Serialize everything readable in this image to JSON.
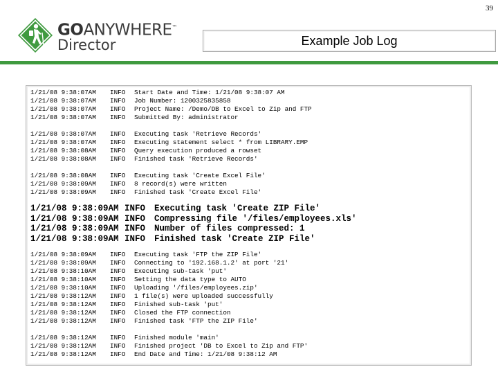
{
  "page_number": "39",
  "logo": {
    "brand_go": "GO",
    "brand_rest": "ANYWHERE",
    "brand_tm": "™",
    "product": "Director"
  },
  "title": "Example Job Log",
  "log_blocks": [
    {
      "emphasis": false,
      "entries": [
        {
          "time": "1/21/08 9:38:07AM",
          "level": "INFO",
          "message": "Start Date and Time: 1/21/08 9:38:07 AM"
        },
        {
          "time": "1/21/08 9:38:07AM",
          "level": "INFO",
          "message": "Job Number: 1200325835858"
        },
        {
          "time": "1/21/08 9:38:07AM",
          "level": "INFO",
          "message": "Project Name: /Demo/DB to Excel to Zip and FTP"
        },
        {
          "time": "1/21/08 9:38:07AM",
          "level": "INFO",
          "message": "Submitted By: administrator"
        }
      ]
    },
    {
      "emphasis": false,
      "entries": [
        {
          "time": "1/21/08 9:38:07AM",
          "level": "INFO",
          "message": "Executing task 'Retrieve Records'"
        },
        {
          "time": "1/21/08 9:38:07AM",
          "level": "INFO",
          "message": "Executing statement select * from LIBRARY.EMP"
        },
        {
          "time": "1/21/08 9:38:08AM",
          "level": "INFO",
          "message": "Query execution produced a rowset"
        },
        {
          "time": "1/21/08 9:38:08AM",
          "level": "INFO",
          "message": "Finished task 'Retrieve Records'"
        }
      ]
    },
    {
      "emphasis": false,
      "entries": [
        {
          "time": "1/21/08 9:38:08AM",
          "level": "INFO",
          "message": "Executing task 'Create Excel File'"
        },
        {
          "time": "1/21/08 9:38:09AM",
          "level": "INFO",
          "message": "8 record(s) were written"
        },
        {
          "time": "1/21/08 9:38:09AM",
          "level": "INFO",
          "message": "Finished task 'Create Excel File'"
        }
      ]
    },
    {
      "emphasis": true,
      "entries": [
        {
          "time": "1/21/08 9:38:09AM",
          "level": "INFO",
          "message": "Executing task 'Create ZIP File'"
        },
        {
          "time": "1/21/08 9:38:09AM",
          "level": "INFO",
          "message": "Compressing file '/files/employees.xls'"
        },
        {
          "time": "1/21/08 9:38:09AM",
          "level": "INFO",
          "message": "Number of files compressed: 1"
        },
        {
          "time": "1/21/08 9:38:09AM",
          "level": "INFO",
          "message": "Finished task 'Create ZIP File'"
        }
      ]
    },
    {
      "emphasis": false,
      "entries": [
        {
          "time": "1/21/08 9:38:09AM",
          "level": "INFO",
          "message": "Executing task 'FTP the ZIP File'"
        },
        {
          "time": "1/21/08 9:38:09AM",
          "level": "INFO",
          "message": "Connecting to '192.168.1.2' at port '21'"
        },
        {
          "time": "1/21/08 9:38:10AM",
          "level": "INFO",
          "message": "Executing sub-task 'put'"
        },
        {
          "time": "1/21/08 9:38:10AM",
          "level": "INFO",
          "message": "Setting the data type to AUTO"
        },
        {
          "time": "1/21/08 9:38:10AM",
          "level": "INFO",
          "message": "Uploading '/files/employees.zip'"
        },
        {
          "time": "1/21/08 9:38:12AM",
          "level": "INFO",
          "message": "1 file(s) were uploaded successfully"
        },
        {
          "time": "1/21/08 9:38:12AM",
          "level": "INFO",
          "message": "Finished sub-task 'put'"
        },
        {
          "time": "1/21/08 9:38:12AM",
          "level": "INFO",
          "message": "Closed the FTP connection"
        },
        {
          "time": "1/21/08 9:38:12AM",
          "level": "INFO",
          "message": "Finished task 'FTP the ZIP File'"
        }
      ]
    },
    {
      "emphasis": false,
      "entries": [
        {
          "time": "1/21/08 9:38:12AM",
          "level": "INFO",
          "message": "Finished module 'main'"
        },
        {
          "time": "1/21/08 9:38:12AM",
          "level": "INFO",
          "message": "Finished project 'DB to Excel to Zip and FTP'"
        },
        {
          "time": "1/21/08 9:38:12AM",
          "level": "INFO",
          "message": "End Date and Time: 1/21/08 9:38:12 AM"
        }
      ]
    }
  ],
  "colors": {
    "accent_green": "#3f9a3f",
    "panel_border": "#b8b8b8"
  }
}
